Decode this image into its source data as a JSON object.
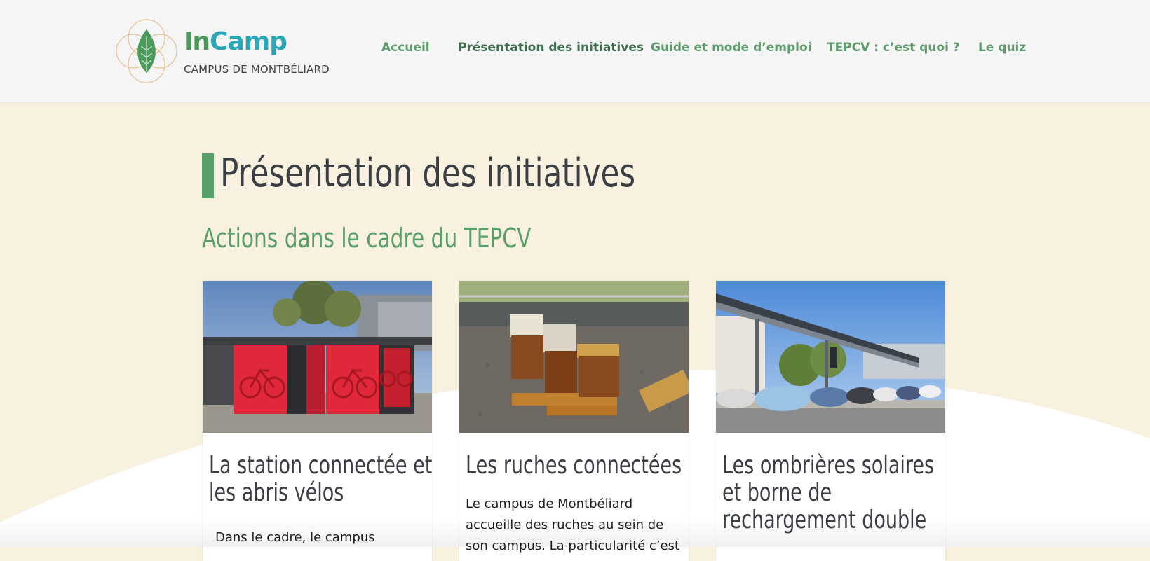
{
  "logo": {
    "brand_in": "In",
    "brand_camp": "Camp",
    "subtitle": "CAMPUS DE MONTBÉLIARD",
    "icon": "leaf-icon"
  },
  "nav": {
    "items": [
      {
        "label": "Accueil"
      },
      {
        "label": "Présentation des initiatives",
        "active": true
      },
      {
        "label": "Guide et mode d’emploi"
      },
      {
        "label": "TEPCV : c’est quoi ?"
      },
      {
        "label": "Le quiz"
      }
    ]
  },
  "main": {
    "page_title": "Présentation des initiatives",
    "section_title": "Actions dans le cadre du TEPCV",
    "cards": [
      {
        "title": "La station connectée et les abris vélos",
        "text": "Dans le cadre, le campus",
        "image": "bike-shelter-photo"
      },
      {
        "title": "Les ruches connectées",
        "text": "Le campus de Montbéliard accueille des ruches au sein de son campus. La particularité c’est que deux de",
        "image": "beehives-photo"
      },
      {
        "title": "Les ombrières solaires et borne de rechargement double",
        "text": "",
        "image": "solar-carport-photo"
      }
    ]
  },
  "colors": {
    "header_bg": "#f5f5f6",
    "page_bg": "#f8f1df",
    "accent_green": "#5a9e69",
    "nav_green": "#5c9c6a",
    "nav_active": "#3d6e4d",
    "title_text": "#3b3f44",
    "brand_teal": "#2aa6b8"
  }
}
